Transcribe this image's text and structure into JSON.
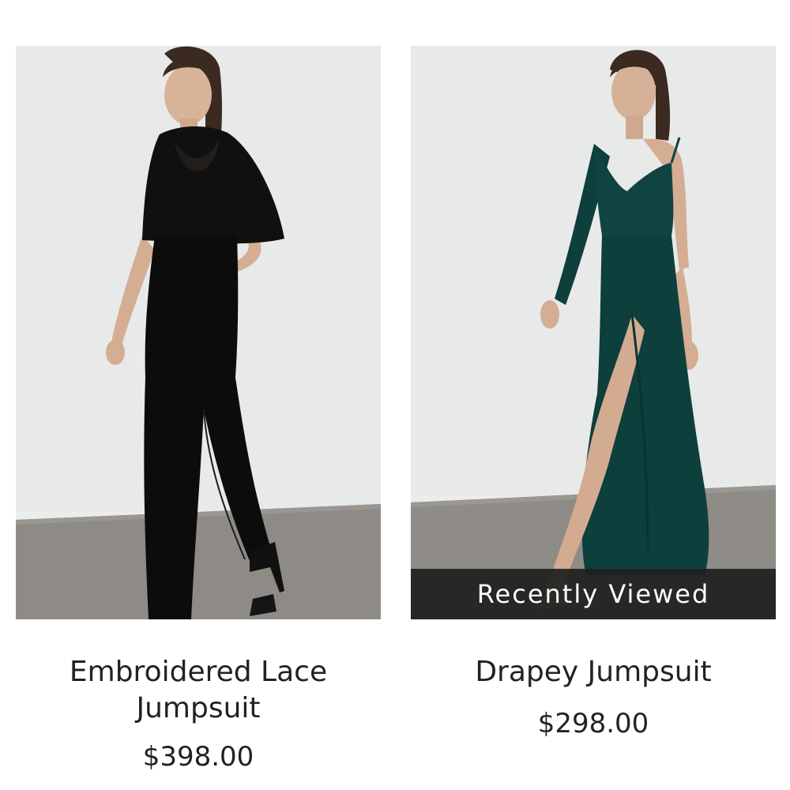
{
  "products": [
    {
      "name": "Embroidered Lace Jumpsuit",
      "price": "$398.00",
      "image_alt": "model wearing black jumpsuit with embroidered lace cape top"
    },
    {
      "name": "Drapey Jumpsuit",
      "price": "$298.00",
      "badge": "Recently Viewed",
      "image_alt": "model wearing dark green one-sleeve jumpsuit with high slit"
    }
  ],
  "colors": {
    "background": "#ffffff",
    "studio_wall": "#e9eaea",
    "studio_floor": "#8f8b86",
    "badge_bg": "#1e201e",
    "text": "#222222",
    "black_garment": "#0c0c0c",
    "green_garment": "#0d3f3c"
  }
}
